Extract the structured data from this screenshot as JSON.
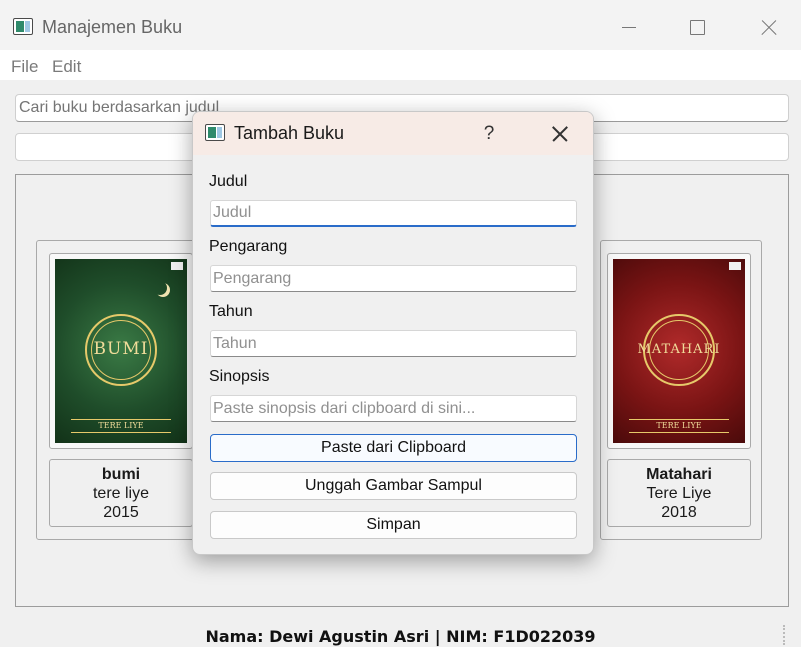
{
  "window": {
    "title": "Manajemen Buku"
  },
  "menu": {
    "items": [
      "File",
      "Edit"
    ]
  },
  "search": {
    "placeholder": "Cari buku berdasarkan judul"
  },
  "books": [
    {
      "title": "bumi",
      "author": "tere liye",
      "year": "2015",
      "cover_title": "BUMI",
      "cover_author": "TERE LIYE"
    },
    {
      "title": "Matahari",
      "author": "Tere Liye",
      "year": "2018",
      "cover_title": "MATAHARI",
      "cover_author": "TERE LIYE"
    }
  ],
  "footer": {
    "text": "Nama: Dewi Agustin Asri | NIM: F1D022039"
  },
  "dialog": {
    "title": "Tambah Buku",
    "help_label": "?",
    "fields": [
      {
        "label": "Judul",
        "placeholder": "Judul"
      },
      {
        "label": "Pengarang",
        "placeholder": "Pengarang"
      },
      {
        "label": "Tahun",
        "placeholder": "Tahun"
      },
      {
        "label": "Sinopsis",
        "placeholder": "Paste sinopsis dari clipboard di sini..."
      }
    ],
    "buttons": {
      "paste": "Paste dari Clipboard",
      "upload": "Unggah Gambar Sampul",
      "save": "Simpan"
    }
  },
  "colors": {
    "focus_accent": "#2a6cc9",
    "dialog_titlebar": "#f7ebe6"
  }
}
